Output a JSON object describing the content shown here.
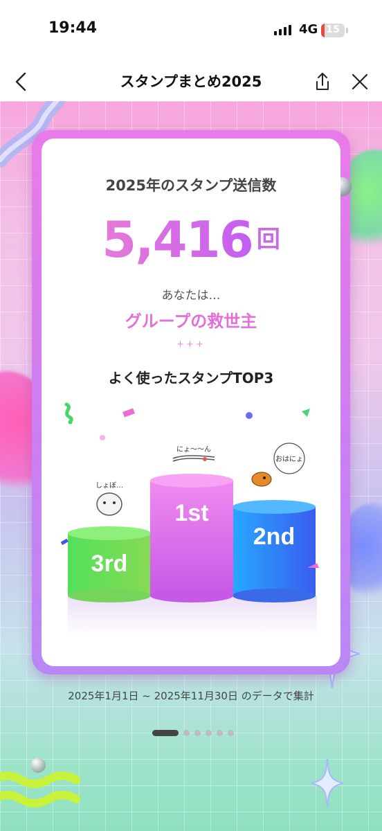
{
  "status_bar": {
    "time": "19:44",
    "network": "4G",
    "battery": "15",
    "battery_level": 0.15
  },
  "nav": {
    "title": "スタンプまとめ2025"
  },
  "card": {
    "heading": "2025年のスタンプ送信数",
    "count": "5,416",
    "count_unit": "回",
    "you_are": "あなたは…",
    "role": "グループの救世主",
    "sparkle": "+++",
    "top3_title": "よく使ったスタンプTOP3",
    "podium": [
      {
        "rank": "1st",
        "sticker_text": "にょ〜〜ん",
        "color": "#e273ea"
      },
      {
        "rank": "2nd",
        "sticker_text": "おはにょ",
        "color": "#3f86f2"
      },
      {
        "rank": "3rd",
        "sticker_text": "しょぼ…",
        "color": "#6bdc55"
      }
    ]
  },
  "footer": {
    "range": "2025年1月1日 ~ 2025年11月30日 のデータで集計",
    "page_count": 6,
    "active_page": 1
  },
  "colors": {
    "accent": "#e36fd8",
    "frame": "#d07bef"
  },
  "icons": [
    "signal-icon",
    "battery-icon",
    "back-chevron-icon",
    "share-icon",
    "close-icon"
  ]
}
